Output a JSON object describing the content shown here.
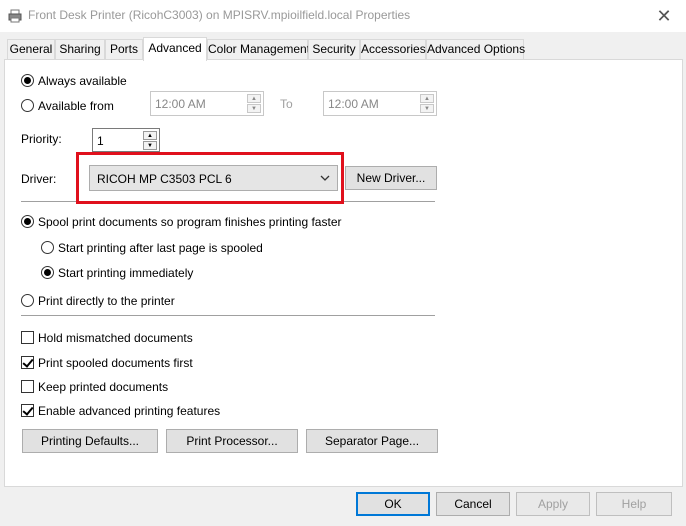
{
  "window": {
    "title": "Front Desk Printer (RicohC3003) on MPISRV.mpioilfield.local Properties",
    "close_glyph": "✕"
  },
  "tabs": [
    {
      "label": "General"
    },
    {
      "label": "Sharing"
    },
    {
      "label": "Ports"
    },
    {
      "label": "Advanced",
      "active": true
    },
    {
      "label": "Color Management"
    },
    {
      "label": "Security"
    },
    {
      "label": "Accessories"
    },
    {
      "label": "Advanced Options"
    }
  ],
  "availability": {
    "always_label": "Always available",
    "from_label": "Available from",
    "always_selected": true,
    "from_time": "12:00 AM",
    "to_label": "To",
    "to_time": "12:00 AM"
  },
  "priority": {
    "label": "Priority:",
    "value": "1"
  },
  "driver": {
    "label": "Driver:",
    "selected": "RICOH MP C3503 PCL 6",
    "new_driver_label": "New Driver...",
    "highlight_color": "#e0101c"
  },
  "spool": {
    "spool_label": "Spool print documents so program finishes printing faster",
    "after_last_label": "Start printing after last page is spooled",
    "immediately_label": "Start printing immediately",
    "direct_label": "Print directly to the printer"
  },
  "options": [
    {
      "label": "Hold mismatched documents",
      "checked": false
    },
    {
      "label": "Print spooled documents first",
      "checked": true
    },
    {
      "label": "Keep printed documents",
      "checked": false
    },
    {
      "label": "Enable advanced printing features",
      "checked": true
    }
  ],
  "buttons": {
    "printing_defaults": "Printing Defaults...",
    "print_processor": "Print Processor...",
    "separator_page": "Separator Page...",
    "ok": "OK",
    "cancel": "Cancel",
    "apply": "Apply",
    "help": "Help"
  },
  "icons": {
    "printer": "printer-icon",
    "close": "close-icon",
    "chevron": "chevron-down-icon"
  }
}
